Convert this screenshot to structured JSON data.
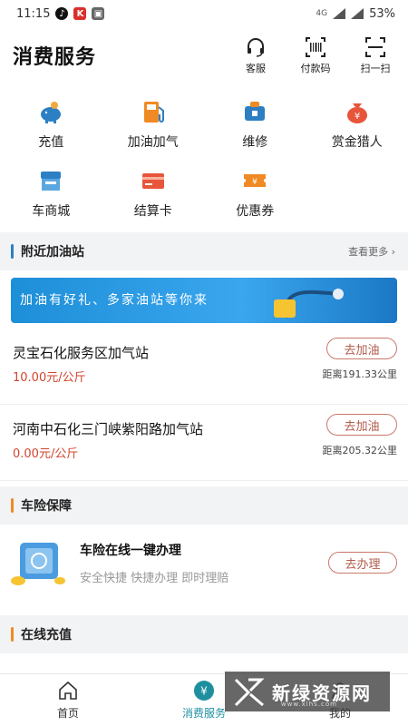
{
  "status": {
    "time": "11:15",
    "signal": "4G",
    "battery": "53%"
  },
  "header": {
    "title": "消费服务",
    "actions": [
      {
        "label": "客服",
        "icon": "headset-icon"
      },
      {
        "label": "付款码",
        "icon": "barcode-icon"
      },
      {
        "label": "扫一扫",
        "icon": "scan-icon"
      }
    ]
  },
  "services": [
    {
      "label": "充值",
      "icon": "piggy-bank-icon"
    },
    {
      "label": "加油加气",
      "icon": "fuel-pump-icon"
    },
    {
      "label": "维修",
      "icon": "repair-icon"
    },
    {
      "label": "赏金猎人",
      "icon": "money-bag-icon"
    },
    {
      "label": "车商城",
      "icon": "store-icon"
    },
    {
      "label": "结算卡",
      "icon": "card-icon"
    },
    {
      "label": "优惠券",
      "icon": "coupon-icon"
    }
  ],
  "nearby": {
    "title": "附近加油站",
    "more": "查看更多",
    "banner_text": "加油有好礼、多家油站等你来",
    "stations": [
      {
        "name": "灵宝石化服务区加气站",
        "price": "10.00元/公斤",
        "action": "去加油",
        "distance": "距离191.33公里"
      },
      {
        "name": "河南中石化三门峡紫阳路加气站",
        "price": "0.00元/公斤",
        "action": "去加油",
        "distance": "距离205.32公里"
      }
    ]
  },
  "insurance": {
    "section_title": "车险保障",
    "title": "车险在线一键办理",
    "subtitle": "安全快捷 快捷办理 即时理赔",
    "action": "去办理"
  },
  "recharge": {
    "section_title": "在线充值"
  },
  "tabs": [
    {
      "label": "首页",
      "icon": "home-icon"
    },
    {
      "label": "消费服务",
      "icon": "yen-icon",
      "active": true
    },
    {
      "label": "我的",
      "icon": "user-icon"
    }
  ],
  "watermark": {
    "text": "新绿资源网",
    "url": "www.xlhs.com"
  },
  "colors": {
    "accent": "#1f8fa0",
    "price": "#d2452e",
    "button_border": "#c8796a",
    "bar_blue": "#2d7fc4",
    "bar_orange": "#f08a24"
  }
}
